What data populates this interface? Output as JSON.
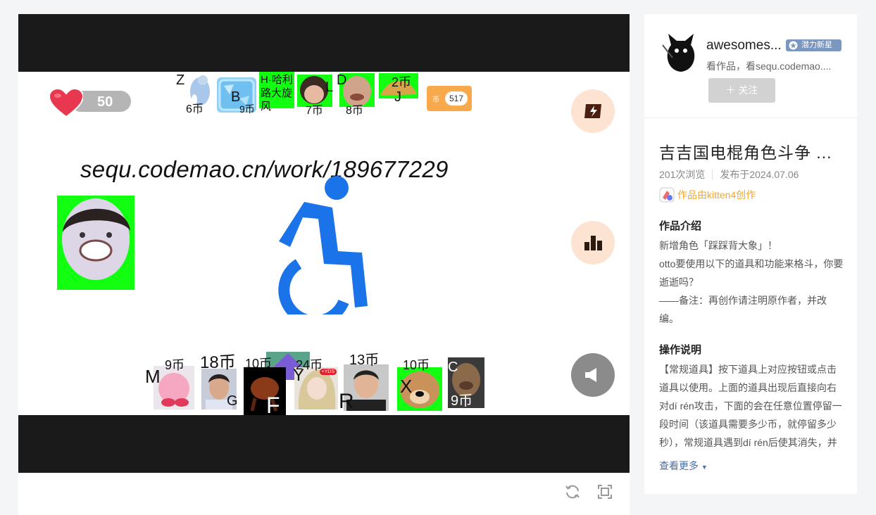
{
  "game": {
    "lives": "50",
    "coin_label": "币",
    "coin_value": "517",
    "url_text": "sequ.codemao.cn/work/189677229",
    "top_items": [
      {
        "key": "Z",
        "price": "6币"
      },
      {
        "key": "B",
        "price": "9币"
      },
      {
        "key": "H·哈利路大旋风",
        "price": ""
      },
      {
        "key": "L",
        "price": "7币"
      },
      {
        "key": "D",
        "price": "8币"
      },
      {
        "key": "J",
        "price": "2币"
      }
    ],
    "bottom_items": [
      {
        "key": "M",
        "price": "9币"
      },
      {
        "key": "G",
        "price": "18币"
      },
      {
        "key": "F",
        "price": "10币"
      },
      {
        "key": "Y",
        "price": "24币"
      },
      {
        "key": "R",
        "price": "13币"
      },
      {
        "key": "X",
        "price": "10币"
      },
      {
        "key": "C",
        "price": "9币"
      }
    ],
    "yds_tag": "+YDS",
    "colors": {
      "green_screen": "#12ff12",
      "accessibility_blue": "#1a73e8",
      "button_peach": "#fde3d2",
      "coin_orange": "#f7a94b"
    }
  },
  "author": {
    "name": "awesomes...",
    "badge": "潜力新星",
    "subtitle": "看作品，看sequ.codemao....",
    "follow_label": "关注"
  },
  "work": {
    "title": "吉吉国电棍角色斗争 ...",
    "views": "201次浏览",
    "published": "发布于2024.07.06",
    "creator": "作品由kitten4创作",
    "intro_heading": "作品介绍",
    "intro_lines": [
      "新增角色「踩踩背大象」！",
      "otto要使用以下的道具和功能来格斗，你要逝逝吗？",
      "——备注：再创作请注明原作者，并改编。"
    ],
    "ops_heading": "操作说明",
    "ops_text": "【常规道具】按下道具上对应按钮或点击道具以使用。上面的道具出现后直接向右对dí rén攻击，下面的会在任意位置停留一段时间（该道具需要多少币，就停留多少秒），常规道具遇到dí rén后使其消失，并",
    "see_more": "查看更多"
  }
}
